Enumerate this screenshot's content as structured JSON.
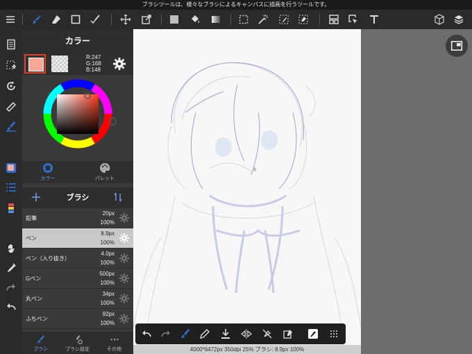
{
  "status_bar": {
    "text": "ブラシツールは、様々なブラシによるキャンバスに描画を行うツールです。"
  },
  "toolbar": {
    "items": [
      "brush-icon",
      "eraser-icon",
      "rectangle-icon",
      "brush-edit-icon",
      "move-icon",
      "transform-icon",
      "fill-color-icon",
      "bucket-icon",
      "gradient-icon",
      "select-rect-icon",
      "magic-wand-icon",
      "select-pen-icon",
      "select-eraser-icon",
      "frame-icon",
      "operation-icon",
      "text-icon",
      "3d-icon",
      "layers-icon"
    ]
  },
  "color_panel": {
    "title": "カラー",
    "r_label": "R:247",
    "g_label": "G:168",
    "b_label": "B:148",
    "primary_color": "#f7a894",
    "tab_color": "カラー",
    "tab_palette": "パレット"
  },
  "brush_panel": {
    "title": "ブラシ",
    "brushes": [
      {
        "name": "鉛筆",
        "size": "20px",
        "opacity": "100%"
      },
      {
        "name": "ペン",
        "size": "8.9px",
        "opacity": "100%"
      },
      {
        "name": "ペン（入り抜き）",
        "size": "4.0px",
        "opacity": "100%"
      },
      {
        "name": "Gペン",
        "size": "500px",
        "opacity": "100%"
      },
      {
        "name": "丸ペン",
        "size": "34px",
        "opacity": "100%"
      },
      {
        "name": "ふちペン",
        "size": "92px",
        "opacity": "100%"
      }
    ],
    "selected_index": 1,
    "tab_brush": "ブラシ",
    "tab_brush_settings": "ブラシ設定",
    "tab_other": "その他"
  },
  "canvas_info": "4000*6472px 350dpi 25% ブラシ: 8.9px 100%",
  "colors": {
    "accent": "#2f6fd0",
    "toolbar_bg": "#2a2a2a",
    "panel_bg": "#3a3a3a",
    "selected_row": "#c9c9c9"
  }
}
